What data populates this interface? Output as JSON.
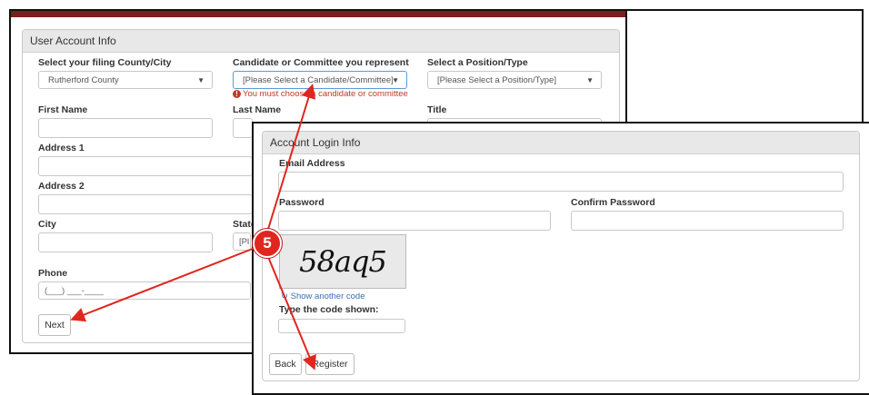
{
  "account_info": {
    "title": "User Account Info",
    "county_label": "Select your filing County/City",
    "county_value": "Rutherford County",
    "candidate_label": "Candidate or Committee you represent",
    "candidate_value": "[Please Select a Candidate/Committee]",
    "candidate_error": "You must choose a candidate or committee",
    "position_label": "Select a Position/Type",
    "position_value": "[Please Select a Position/Type]",
    "first_name_label": "First Name",
    "last_name_label": "Last Name",
    "title_label": "Title",
    "address1_label": "Address 1",
    "address2_label": "Address 2",
    "city_label": "City",
    "state_label": "State",
    "state_value_partial": "[Pl",
    "phone_label": "Phone",
    "phone_placeholder": "(___) ___-____",
    "next_button": "Next"
  },
  "login_info": {
    "title": "Account Login Info",
    "email_label": "Email Address",
    "password_label": "Password",
    "confirm_password_label": "Confirm Password",
    "captcha_text": "58aq5",
    "show_another_code": "Show another code",
    "type_code_label": "Type the code shown:",
    "back_button": "Back",
    "register_button": "Register"
  },
  "annotation": {
    "step_number": "5",
    "color": "#e0261e"
  }
}
